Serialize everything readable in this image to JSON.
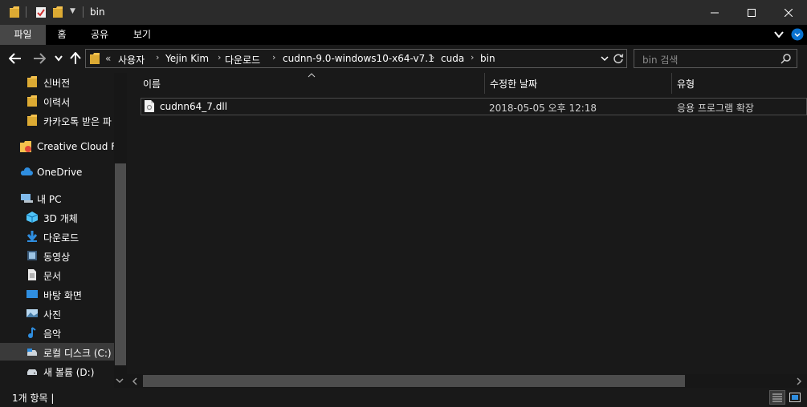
{
  "window": {
    "title": "bin",
    "controls": {
      "minimize": "minimize-icon",
      "maximize": "maximize-icon",
      "close": "close-icon"
    }
  },
  "ribbon": {
    "tabs": [
      {
        "label": "파일",
        "active": true
      },
      {
        "label": "홈",
        "active": false
      },
      {
        "label": "공유",
        "active": false
      },
      {
        "label": "보기",
        "active": false
      }
    ]
  },
  "address": {
    "overflow": "«",
    "crumbs": [
      "사용자",
      "Yejin Kim",
      "다운로드",
      "cudnn-9.0-windows10-x64-v7.1",
      "cuda",
      "bin"
    ]
  },
  "search": {
    "placeholder": "bin 검색"
  },
  "sidebar": {
    "items": [
      {
        "label": "신버전",
        "icon": "folder-icon"
      },
      {
        "label": "이력서",
        "icon": "folder-icon"
      },
      {
        "label": "카카오톡 받은 파",
        "icon": "folder-icon"
      },
      {
        "label": "Creative Cloud Fil",
        "icon": "creative-cloud-folder-icon"
      },
      {
        "label": "OneDrive",
        "icon": "onedrive-icon"
      },
      {
        "label": "내 PC",
        "icon": "pc-icon"
      },
      {
        "label": "3D 개체",
        "icon": "3d-objects-icon"
      },
      {
        "label": "다운로드",
        "icon": "download-icon"
      },
      {
        "label": "동영상",
        "icon": "video-icon"
      },
      {
        "label": "문서",
        "icon": "document-icon"
      },
      {
        "label": "바탕 화면",
        "icon": "desktop-icon"
      },
      {
        "label": "사진",
        "icon": "pictures-icon"
      },
      {
        "label": "음악",
        "icon": "music-icon"
      },
      {
        "label": "로컬 디스크 (C:)",
        "icon": "local-disk-icon",
        "selected": true
      },
      {
        "label": "새 볼륨 (D:)",
        "icon": "drive-icon"
      }
    ]
  },
  "columns": {
    "name": "이름",
    "date": "수정한 날짜",
    "type": "유형"
  },
  "files": [
    {
      "name": "cudnn64_7.dll",
      "date": "2018-05-05 오후 12:18",
      "type": "응용 프로그램 확장"
    }
  ],
  "status": {
    "text": "1개 항목 |"
  },
  "colors": {
    "accent_folder": "#f4c14d",
    "background": "#191919",
    "ribbon_active": "#474747"
  }
}
